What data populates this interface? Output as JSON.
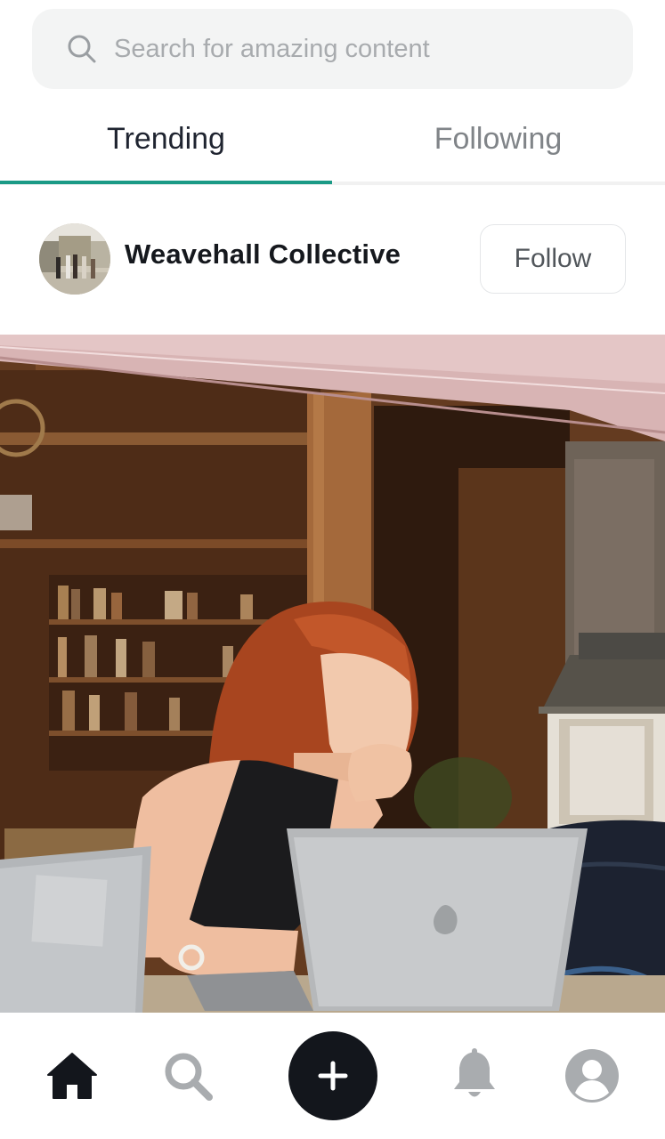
{
  "search": {
    "placeholder": "Search for amazing content"
  },
  "tabs": [
    {
      "label": "Trending",
      "active": true
    },
    {
      "label": "Following",
      "active": false
    }
  ],
  "post": {
    "author": "Weavehall Collective",
    "follow_label": "Follow"
  },
  "nav": {
    "items": [
      {
        "icon": "home-icon",
        "active": true
      },
      {
        "icon": "search-icon",
        "active": false
      },
      {
        "icon": "plus-icon",
        "active": false
      },
      {
        "icon": "bell-icon",
        "active": false
      },
      {
        "icon": "profile-icon",
        "active": false
      }
    ]
  },
  "colors": {
    "accent": "#1b9a86",
    "dark": "#13161c",
    "inactive_icon": "#a9acaf",
    "search_bg": "#f3f4f4"
  }
}
